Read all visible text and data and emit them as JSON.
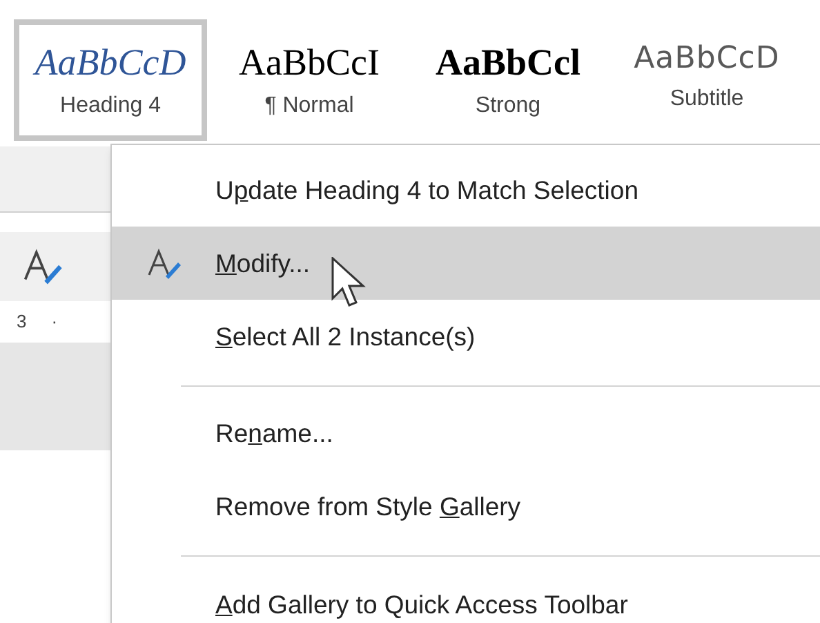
{
  "style_gallery": [
    {
      "kind": "heading",
      "sample": "AaBbCcD",
      "label": "Heading 4",
      "selected": true
    },
    {
      "kind": "normal",
      "sample": "AaBbCcI",
      "label": "¶ Normal",
      "selected": false
    },
    {
      "kind": "strong",
      "sample": "AaBbCcl",
      "label": "Strong",
      "selected": false
    },
    {
      "kind": "subtitle",
      "sample": "AaBbCcD",
      "label": "Subtitle",
      "selected": false
    }
  ],
  "ruler": {
    "mark": "3",
    "tick": "·"
  },
  "context_menu": [
    {
      "kind": "item",
      "before": "U",
      "key": "p",
      "after": "date Heading 4 to Match Selection",
      "icon": false,
      "selected": false
    },
    {
      "kind": "item",
      "key": "M",
      "after": "odify...",
      "icon": true,
      "selected": true
    },
    {
      "kind": "item",
      "key": "S",
      "after": "elect All 2 Instance(s)",
      "icon": false,
      "selected": false
    },
    {
      "kind": "separator"
    },
    {
      "kind": "item",
      "before": "Re",
      "key": "n",
      "after": "ame...",
      "icon": false,
      "selected": false
    },
    {
      "kind": "item",
      "before": "Remove from Style ",
      "key": "G",
      "after": "allery",
      "icon": false,
      "selected": false
    },
    {
      "kind": "separator"
    },
    {
      "kind": "item",
      "key": "A",
      "after": "dd Gallery to Quick Access Toolbar",
      "icon": false,
      "selected": false
    }
  ]
}
